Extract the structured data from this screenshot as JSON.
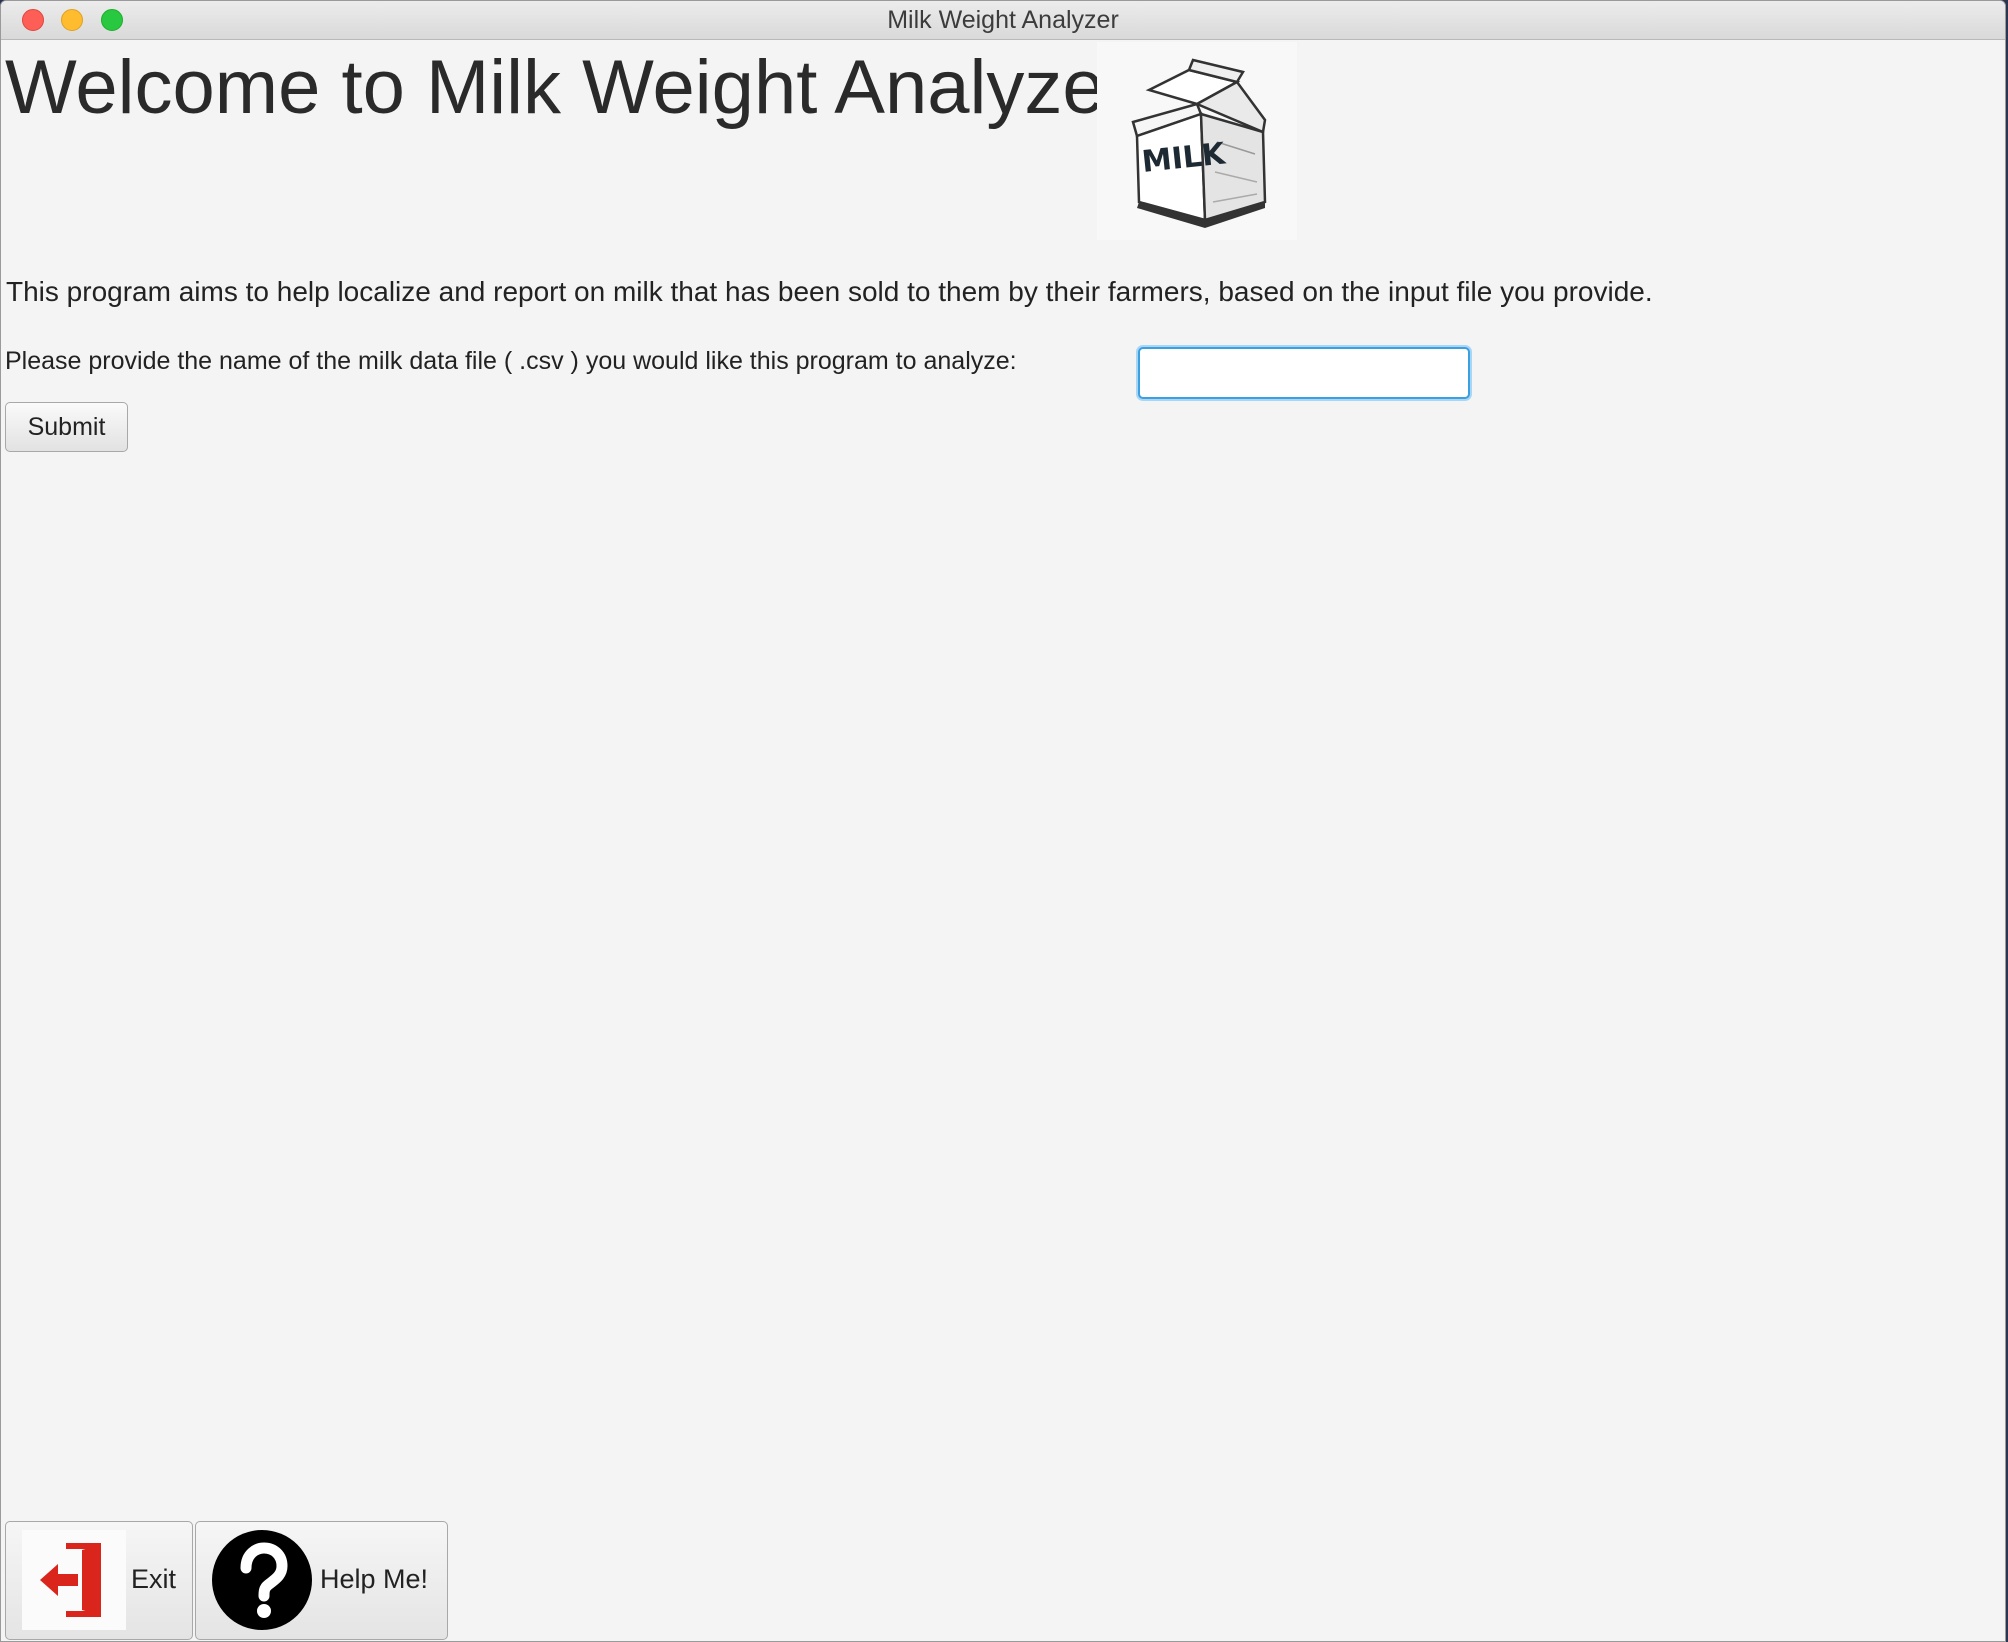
{
  "window": {
    "title": "Milk Weight Analyzer"
  },
  "main": {
    "heading": "Welcome to Milk Weight Analyzer!",
    "logo": {
      "icon": "milk-carton-icon",
      "text": "MILK"
    },
    "description": "This program aims to help localize and report on milk that has been sold to them by their farmers, based on the input file you provide.",
    "prompt_label": "Please provide the name of the milk data file ( .csv ) you would like this program to analyze:",
    "file_input": {
      "value": "",
      "placeholder": ""
    },
    "submit_label": "Submit"
  },
  "footer": {
    "exit": {
      "label": "Exit",
      "icon": "exit-door-icon",
      "icon_color": "#d9251c"
    },
    "help": {
      "label": "Help Me!",
      "icon": "question-mark-icon"
    }
  },
  "colors": {
    "focus_ring": "#3aa0e0",
    "background": "#f4f4f4"
  }
}
